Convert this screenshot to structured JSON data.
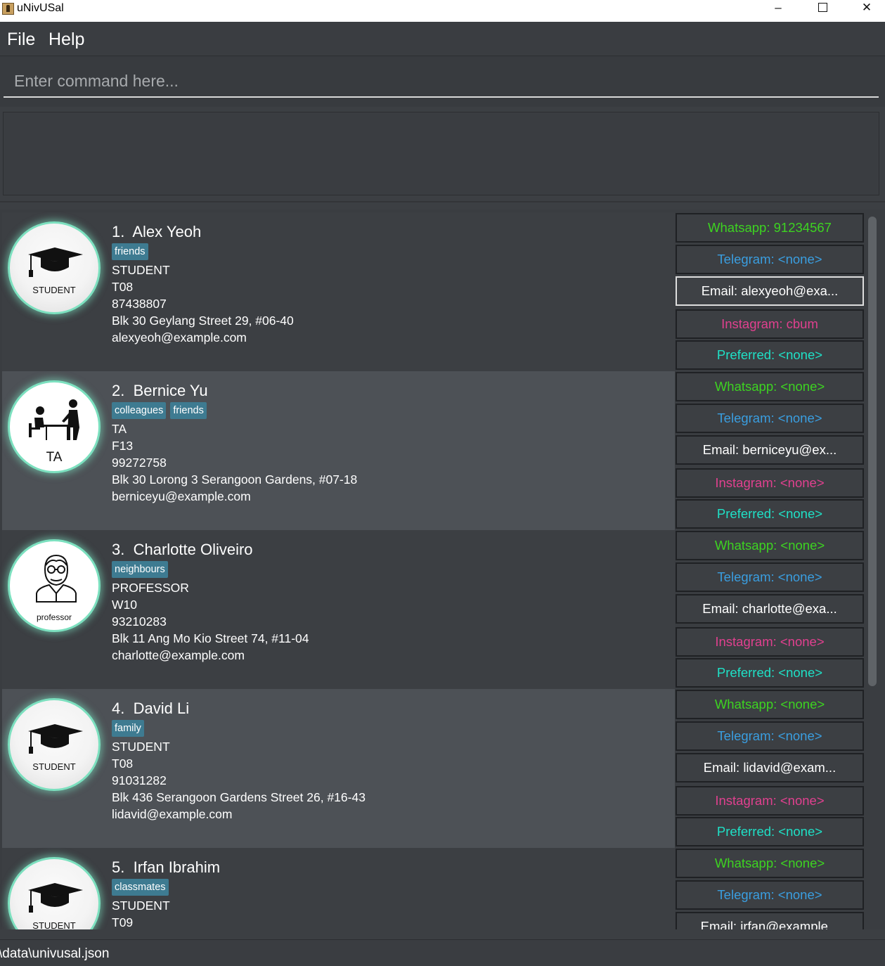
{
  "window": {
    "title": "uNivUSal"
  },
  "menu": {
    "file": "File",
    "help": "Help"
  },
  "command": {
    "placeholder": "Enter command here..."
  },
  "result": {
    "text": ""
  },
  "persons": [
    {
      "index": "1.",
      "name": "Alex Yeoh",
      "tags": [
        "friends"
      ],
      "role": "STUDENT",
      "group": "T08",
      "phone": "87438807",
      "address": "Blk 30 Geylang Street 29, #06-40",
      "email": "alexyeoh@example.com",
      "avatar": {
        "icon": "graduation-cap-icon",
        "label": "STUDENT"
      },
      "contacts": {
        "whatsapp": "Whatsapp: 91234567",
        "telegram": "Telegram: <none>",
        "email": "Email: alexyeoh@exa...",
        "instagram": "Instagram: cbum",
        "preferred": "Preferred: <none>"
      }
    },
    {
      "index": "2.",
      "name": "Bernice Yu",
      "tags": [
        "colleagues",
        "friends"
      ],
      "role": "TA",
      "group": "F13",
      "phone": "99272758",
      "address": "Blk 30 Lorong 3 Serangoon Gardens, #07-18",
      "email": "berniceyu@example.com",
      "avatar": {
        "icon": "teaching-assistant-icon",
        "label": "TA"
      },
      "contacts": {
        "whatsapp": "Whatsapp: <none>",
        "telegram": "Telegram: <none>",
        "email": "Email: berniceyu@ex...",
        "instagram": "Instagram: <none>",
        "preferred": "Preferred: <none>"
      }
    },
    {
      "index": "3.",
      "name": "Charlotte Oliveiro",
      "tags": [
        "neighbours"
      ],
      "role": "PROFESSOR",
      "group": "W10",
      "phone": "93210283",
      "address": "Blk 11 Ang Mo Kio Street 74, #11-04",
      "email": "charlotte@example.com",
      "avatar": {
        "icon": "professor-icon",
        "label": "professor"
      },
      "contacts": {
        "whatsapp": "Whatsapp: <none>",
        "telegram": "Telegram: <none>",
        "email": "Email: charlotte@exa...",
        "instagram": "Instagram: <none>",
        "preferred": "Preferred: <none>"
      }
    },
    {
      "index": "4.",
      "name": "David Li",
      "tags": [
        "family"
      ],
      "role": "STUDENT",
      "group": "T08",
      "phone": "91031282",
      "address": "Blk 436 Serangoon Gardens Street 26, #16-43",
      "email": "lidavid@example.com",
      "avatar": {
        "icon": "graduation-cap-icon",
        "label": "STUDENT"
      },
      "contacts": {
        "whatsapp": "Whatsapp: <none>",
        "telegram": "Telegram: <none>",
        "email": "Email: lidavid@exam...",
        "instagram": "Instagram: <none>",
        "preferred": "Preferred: <none>"
      }
    },
    {
      "index": "5.",
      "name": "Irfan Ibrahim",
      "tags": [
        "classmates"
      ],
      "role": "STUDENT",
      "group": "T09",
      "avatar": {
        "icon": "graduation-cap-icon",
        "label": "STUDENT"
      },
      "contacts": {
        "whatsapp": "Whatsapp: <none>",
        "telegram": "Telegram: <none>",
        "email": "Email: irfan@example..."
      }
    }
  ],
  "status": {
    "path": "\\data\\univusal.json"
  }
}
